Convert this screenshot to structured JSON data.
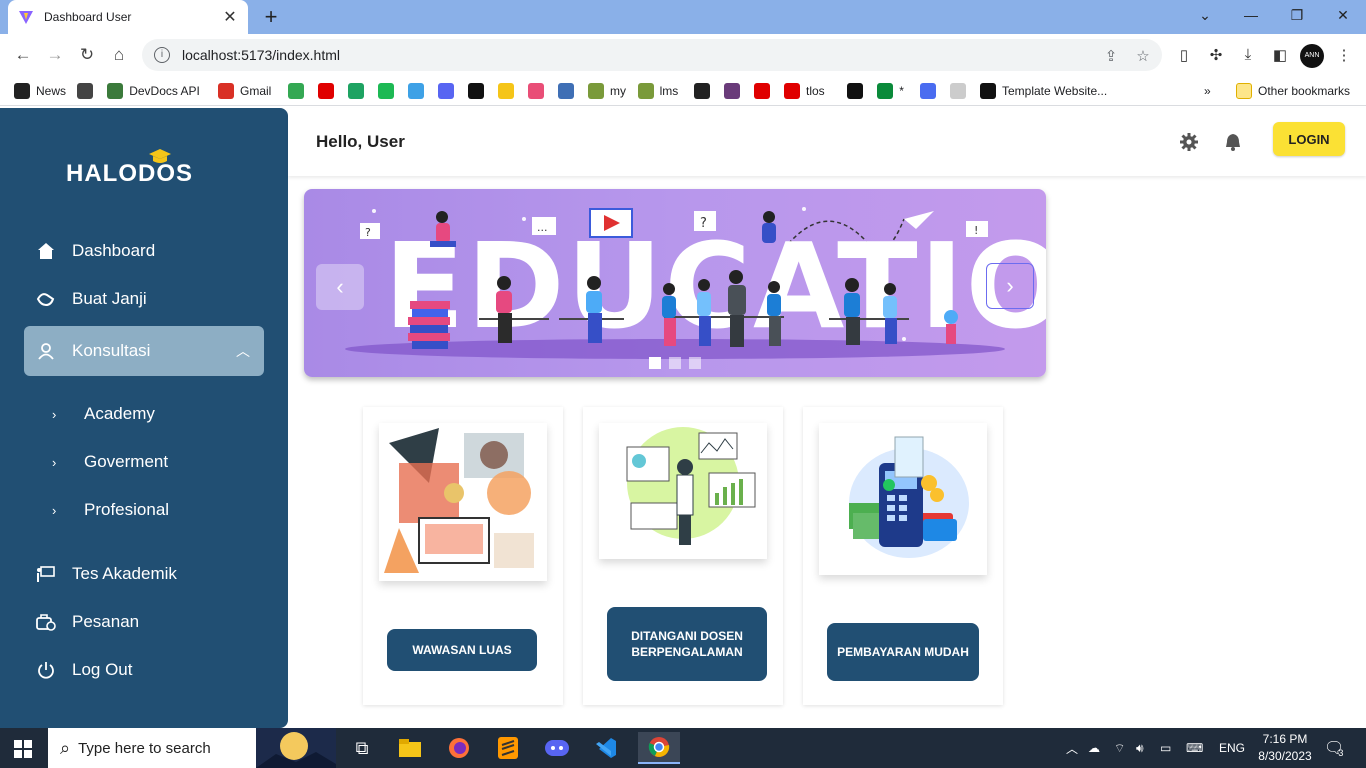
{
  "browser": {
    "tab_title": "Dashboard User",
    "url": "localhost:5173/index.html",
    "profile_initials": "ANN",
    "bookmarks": [
      {
        "label": "News",
        "color": "#222"
      },
      {
        "label": "",
        "color": "#444"
      },
      {
        "label": "DevDocs API",
        "color": "#3b7a3b"
      },
      {
        "label": "Gmail",
        "color": "#d93025"
      },
      {
        "label": "",
        "color": "#34a853"
      },
      {
        "label": "",
        "color": "#e00000"
      },
      {
        "label": "",
        "color": "#1ea362"
      },
      {
        "label": "",
        "color": "#1db954"
      },
      {
        "label": "",
        "color": "#3ea1e6"
      },
      {
        "label": "",
        "color": "#5865f2"
      },
      {
        "label": "",
        "color": "#111"
      },
      {
        "label": "",
        "color": "#f5c518"
      },
      {
        "label": "",
        "color": "#e94e77"
      },
      {
        "label": "",
        "color": "#3f6fb5"
      },
      {
        "label": "my",
        "color": "#7a9a3a"
      },
      {
        "label": "lms",
        "color": "#7a9a3a"
      },
      {
        "label": "",
        "color": "#222"
      },
      {
        "label": "",
        "color": "#6a3b7a"
      },
      {
        "label": "",
        "color": "#e00000"
      },
      {
        "label": "tlos",
        "color": "#e00000"
      },
      {
        "label": "",
        "color": "#111"
      },
      {
        "label": "*",
        "color": "#0a8a3a"
      },
      {
        "label": "",
        "color": "#4a6cf0"
      },
      {
        "label": "",
        "color": "#ccc"
      },
      {
        "label": "Template Website...",
        "color": "#111"
      }
    ],
    "overflow": "»",
    "other_bookmarks": "Other bookmarks"
  },
  "app": {
    "logo": "HALODOS",
    "greeting": "Hello, User",
    "login_label": "LOGIN",
    "menu": {
      "dashboard": "Dashboard",
      "buat_janji": "Buat Janji",
      "konsultasi": "Konsultasi",
      "academy": "Academy",
      "goverment": "Goverment",
      "profesional": "Profesional",
      "tes_akademik": "Tes Akademik",
      "pesanan": "Pesanan",
      "logout": "Log Out"
    },
    "carousel": {
      "headline": "EDUCATION",
      "prev": "‹",
      "next": "›",
      "slides": 3,
      "active_slide": 1
    },
    "cards": [
      {
        "button": "WAWASAN LUAS",
        "image": "learning-collage-image"
      },
      {
        "button": "DITANGANI DOSEN BERPENGALAMAN",
        "image": "analytics-presenter-image"
      },
      {
        "button": "PEMBAYARAN MUDAH",
        "image": "payment-terminal-image"
      }
    ],
    "colors": {
      "sidebar": "#214f73",
      "active_menu": "#8daec4",
      "login": "#fbe134"
    }
  },
  "taskbar": {
    "search_placeholder": "Type here to search",
    "language": "ENG",
    "time": "7:16 PM",
    "date": "8/30/2023",
    "notifications": "3"
  }
}
